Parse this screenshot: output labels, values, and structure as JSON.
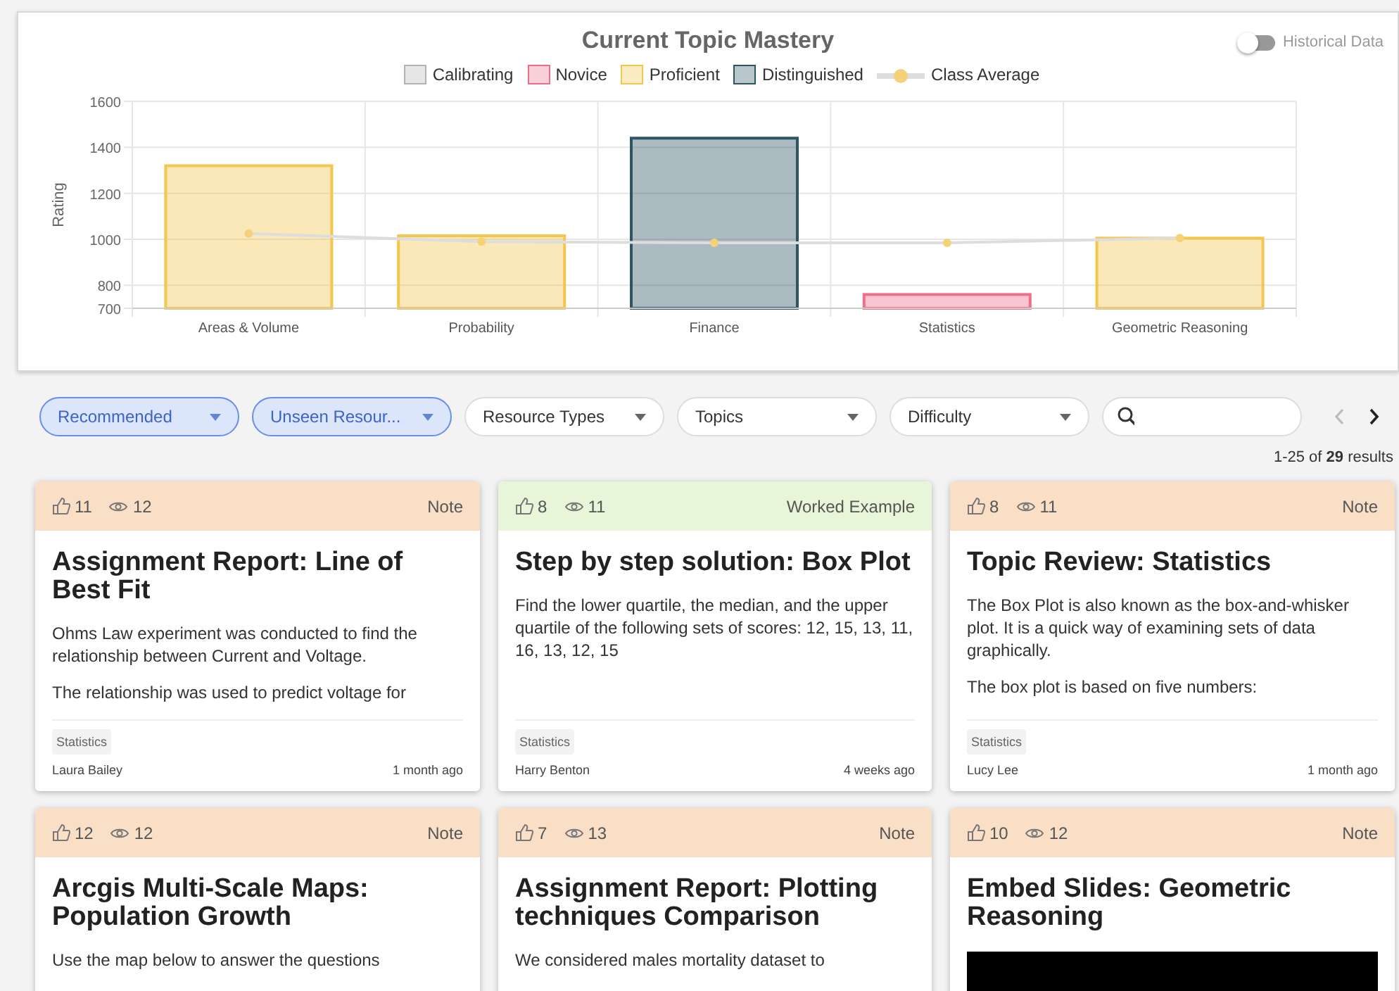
{
  "chart_panel": {
    "historical_toggle": {
      "label": "Historical Data",
      "on": false
    },
    "chart_data": {
      "type": "bar",
      "title": "Current Topic Mastery",
      "ylabel": "Rating",
      "categories": [
        "Areas & Volume",
        "Probability",
        "Finance",
        "Statistics",
        "Geometric Reasoning"
      ],
      "ylim": [
        700,
        1600
      ],
      "yticks": [
        700,
        800,
        1000,
        1200,
        1400,
        1600
      ],
      "grid": true,
      "series": [
        {
          "name": "Calibrating",
          "type": "bar",
          "color": "#b3b3b3",
          "values": [
            null,
            null,
            null,
            null,
            null
          ]
        },
        {
          "name": "Novice",
          "type": "bar",
          "color": "#ee6f8a",
          "values": [
            null,
            null,
            null,
            760,
            null
          ]
        },
        {
          "name": "Proficient",
          "type": "bar",
          "color": "#f5c64e",
          "values": [
            1320,
            1015,
            null,
            null,
            1005
          ]
        },
        {
          "name": "Distinguished",
          "type": "bar",
          "color": "#2e5563",
          "values": [
            null,
            null,
            1440,
            null,
            null
          ]
        },
        {
          "name": "Class Average",
          "type": "line",
          "marker": true,
          "color": "#f5d27a",
          "values": [
            1025,
            990,
            985,
            985,
            1005
          ]
        }
      ]
    }
  },
  "filters": [
    {
      "label": "Recommended",
      "selected": true
    },
    {
      "label": "Unseen Resour...",
      "selected": true
    },
    {
      "label": "Resource Types",
      "selected": false
    },
    {
      "label": "Topics",
      "selected": false
    },
    {
      "label": "Difficulty",
      "selected": false
    }
  ],
  "pagination": {
    "prev_disabled": true,
    "next_disabled": false,
    "summary": "1-25 of **29** results"
  },
  "cards": [
    {
      "likes": "11",
      "views": "12",
      "type": "Note",
      "color": "#f9dfc6",
      "title": "Assignment Report: Line of Best Fit",
      "kind": "text",
      "paragraphs": [
        "Ohms Law experiment was conducted to find the relationship between Current and Voltage.",
        "The relationship was used to predict voltage for"
      ],
      "tag": "Statistics",
      "author": "Laura Bailey",
      "time": "1 month ago"
    },
    {
      "likes": "8",
      "views": "11",
      "type": "Worked Example",
      "color": "#e7f5d8",
      "title": "Step by step solution: Box Plot",
      "kind": "text",
      "paragraphs": [
        "Find the lower quartile, the median, and the upper quartile of the following sets of scores: 12, 15, 13, 11, 16, 13, 12, 15"
      ],
      "tag": "Statistics",
      "author": "Harry Benton",
      "time": "4 weeks ago"
    },
    {
      "likes": "8",
      "views": "11",
      "type": "Note",
      "color": "#f9dfc6",
      "title": "Topic Review: Statistics",
      "kind": "text",
      "paragraphs": [
        "The Box Plot is also known as the box-and-whisker plot. It is a quick way of examining sets of data graphically.",
        "The box plot is based on five numbers:"
      ],
      "tag": "Statistics",
      "author": "Lucy Lee",
      "time": "1 month ago"
    },
    {
      "likes": "12",
      "views": "12",
      "type": "Note",
      "color": "#f9dfc6",
      "title": "Arcgis Multi-Scale Maps: Population Growth",
      "kind": "text",
      "paragraphs": [
        "Use the map below to answer the questions"
      ]
    },
    {
      "likes": "7",
      "views": "13",
      "type": "Note",
      "color": "#f9dfc6",
      "title": "Assignment Report: Plotting techniques Comparison",
      "kind": "text",
      "paragraphs": [
        "We considered males mortality dataset to"
      ]
    },
    {
      "likes": "10",
      "views": "12",
      "type": "Note",
      "color": "#f9dfc6",
      "title": "Embed Slides: Geometric Reasoning",
      "kind": "embed"
    }
  ]
}
